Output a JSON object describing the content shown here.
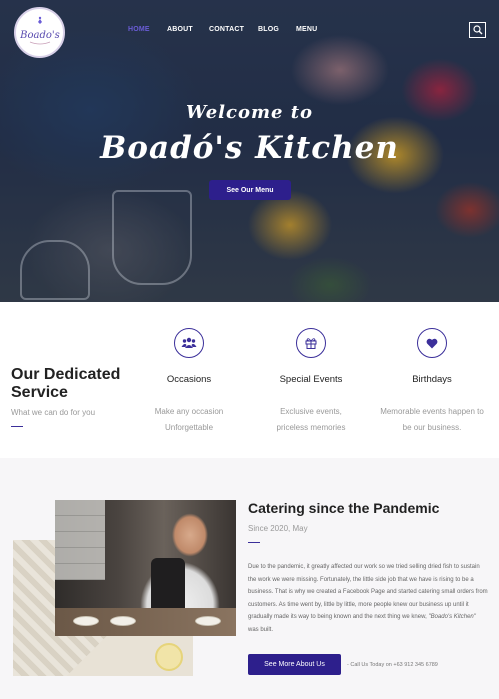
{
  "header": {
    "logo_text": "Boado's",
    "nav": [
      {
        "label": "HOME",
        "active": true
      },
      {
        "label": "ABOUT",
        "active": false
      },
      {
        "label": "CONTACT",
        "active": false
      },
      {
        "label": "BLOG",
        "active": false
      },
      {
        "label": "MENU",
        "active": false
      }
    ],
    "search_icon": "search-icon"
  },
  "hero": {
    "welcome": "Welcome to",
    "title": "Boadó's Kitchen",
    "button_label": "See Our Menu"
  },
  "services": {
    "title": "Our Dedicated Service",
    "subtitle": "What we can do for you",
    "items": [
      {
        "icon": "group-icon",
        "name": "Occasions",
        "desc_line1": "Make any occasion",
        "desc_line2": "Unforgettable"
      },
      {
        "icon": "gift-icon",
        "name": "Special Events",
        "desc_line1": "Exclusive events,",
        "desc_line2": "priceless memories"
      },
      {
        "icon": "heart-icon",
        "name": "Birthdays",
        "desc_line1": "Memorable events happen to",
        "desc_line2": "be our business."
      }
    ]
  },
  "catering": {
    "title": "Catering since the Pandemic",
    "since": "Since 2020, May",
    "body_main": "Due to the pandemic, it greatly affected our work so we tried selling dried fish to sustain the work we were missing. Fortunately, the little side job that we have is rising to be a business. That is why we created a Facebook Page and started catering small orders from customers. As time went by, little by little, more people knew our business up until it gradually made its way to being known and the next thing we knew, ",
    "body_brand": "\"Boado's Kitchen\"",
    "body_end": " was built.",
    "button_label": "See More About Us",
    "call_text": "- Call Us Today on +63 912 345 6789"
  },
  "colors": {
    "accent": "#2d1f8c",
    "nav_active": "#6a5cd6"
  }
}
